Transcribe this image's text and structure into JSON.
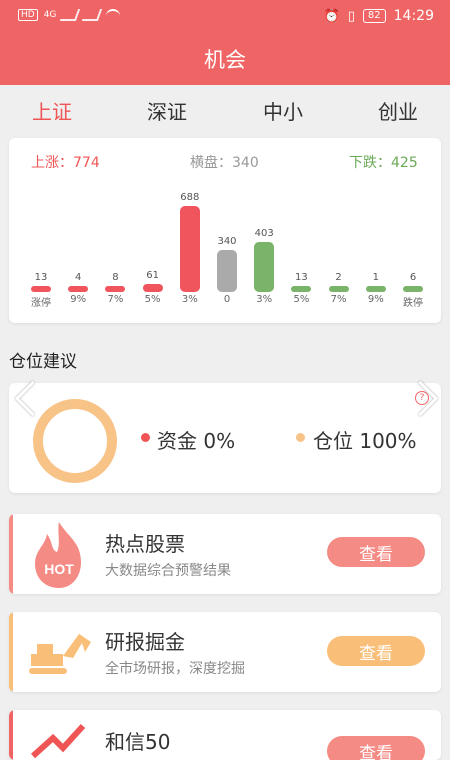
{
  "status": {
    "left": "HD",
    "net": "4G",
    "battery": "82",
    "time": "14:29"
  },
  "title": "机会",
  "tabs": [
    "上证",
    "深证",
    "中小",
    "创业"
  ],
  "stats": {
    "up": "上涨：774",
    "flat": "横盘：340",
    "down": "下跌：425"
  },
  "chart_data": {
    "type": "bar",
    "categories": [
      "涨停",
      "9%",
      "7%",
      "5%",
      "3%",
      "0",
      "3%",
      "5%",
      "7%",
      "9%",
      "跌停"
    ],
    "values": [
      13,
      4,
      8,
      61,
      688,
      340,
      403,
      13,
      2,
      1,
      6
    ],
    "colors": {
      "up": "#f0555e",
      "flat": "#aaaaaa",
      "down": "#7ab36a"
    }
  },
  "position": {
    "section_title": "仓位建议",
    "cash_label": "资金 0%",
    "hold_label": "仓位 100%"
  },
  "features": [
    {
      "icon": "HOT",
      "title": "热点股票",
      "subtitle": "大数据综合预警结果",
      "button": "查看"
    },
    {
      "title": "研报掘金",
      "subtitle": "全市场研报，深度挖掘",
      "button": "查看"
    },
    {
      "title": "和信50",
      "button": "查看"
    }
  ],
  "colors": {
    "primary": "#ef6565",
    "hotBtn": "#f58b85",
    "amberBtn": "#f9bf79",
    "ring": "#f8c387"
  }
}
